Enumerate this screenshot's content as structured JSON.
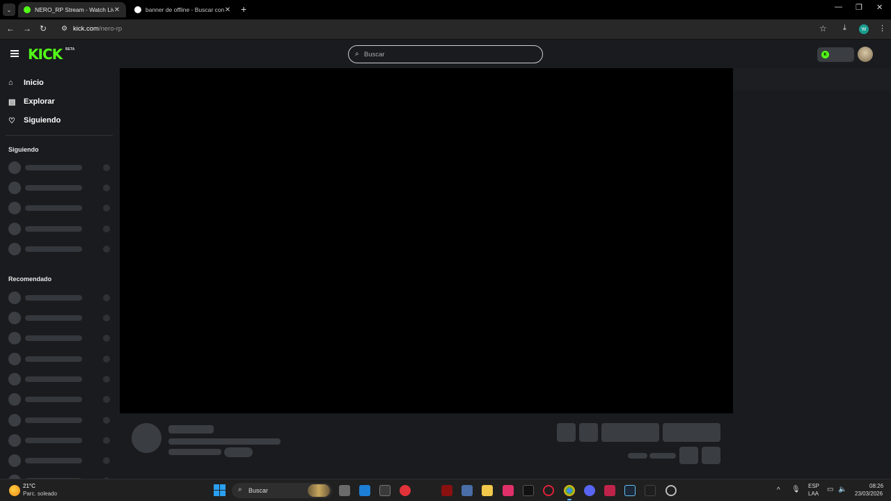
{
  "browser": {
    "tabs": [
      {
        "title": "NERO_RP Stream - Watch Live o",
        "close": "✕",
        "favicon_color": "#53fc18",
        "active": true
      },
      {
        "title": "banner de offline - Buscar con C",
        "close": "✕",
        "favicon_color": "#ffffff",
        "active": false
      }
    ],
    "new_tab": "+",
    "url_host": "kick.com",
    "url_path": "/nero-rp",
    "profile_initial": "W"
  },
  "kick": {
    "logo": "KICK",
    "beta": "BETA",
    "search_placeholder": "Buscar",
    "nav": [
      {
        "label": "Inicio",
        "icon": "home-icon"
      },
      {
        "label": "Explorar",
        "icon": "browse-icon"
      },
      {
        "label": "Siguiendo",
        "icon": "heart-icon"
      }
    ],
    "sections": {
      "following": "Siguiendo",
      "recommended": "Recomendado"
    }
  },
  "taskbar": {
    "temperature": "21°C",
    "condition": "Parc. soleado",
    "search_label": "Buscar",
    "lang_top": "ESP",
    "lang_bottom": "LAA",
    "time": "08:26",
    "date": "23/03/2026"
  },
  "colors": {
    "kick_green": "#53fc18",
    "background": "#191b1f",
    "skeleton": "#3a3d42"
  }
}
